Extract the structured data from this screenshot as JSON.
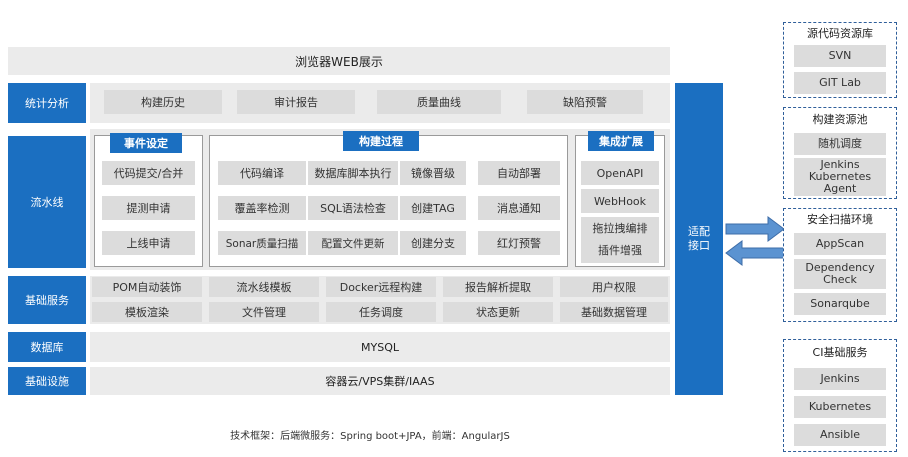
{
  "top_bar": "浏览器WEB展示",
  "rows": {
    "stats": "统计分析",
    "pipeline": "流水线",
    "base_services": "基础服务",
    "database": "数据库",
    "infra": "基础设施"
  },
  "stats_items": [
    "构建历史",
    "审计报告",
    "质量曲线",
    "缺陷预警"
  ],
  "event": {
    "title": "事件设定",
    "items": [
      "代码提交/合并",
      "提测申请",
      "上线申请"
    ]
  },
  "build": {
    "title": "构建过程",
    "grid": [
      [
        "代码编译",
        "数据库脚本执行",
        "镜像晋级",
        "自动部署"
      ],
      [
        "覆盖率检测",
        "SQL语法检查",
        "创建TAG",
        "消息通知"
      ],
      [
        "Sonar质量扫描",
        "配置文件更新",
        "创建分支",
        "红灯预警"
      ]
    ]
  },
  "integration": {
    "title": "集成扩展",
    "items": [
      "OpenAPI",
      "WebHook",
      "拖拉拽编排",
      "插件增强"
    ]
  },
  "base_items": [
    [
      "POM自动装饰",
      "流水线模板",
      "Docker远程构建",
      "报告解析提取",
      "用户权限"
    ],
    [
      "模板渲染",
      "文件管理",
      "任务调度",
      "状态更新",
      "基础数据管理"
    ]
  ],
  "database_value": "MYSQL",
  "infra_value": "容器云/VPS集群/IAAS",
  "adapter": "适配\n接口",
  "footer": "技术框架：后端微服务：Spring boot+JPA，前端：AngularJS",
  "right_panels": [
    {
      "title": "源代码资源库",
      "items": [
        "SVN",
        "GIT Lab"
      ]
    },
    {
      "title": "构建资源池",
      "items": [
        "随机调度",
        "Jenkins\nKubernetes\nAgent"
      ]
    },
    {
      "title": "安全扫描环境",
      "items": [
        "AppScan",
        "Dependency\nCheck",
        "Sonarqube"
      ]
    },
    {
      "title": "CI基础服务",
      "items": [
        "Jenkins",
        "Kubernetes",
        "Ansible"
      ]
    }
  ],
  "colors": {
    "accent": "#1b6fc1",
    "band": "#ebebeb",
    "cell": "#dcdcdc",
    "dashed_border": "#2f5f9a"
  }
}
